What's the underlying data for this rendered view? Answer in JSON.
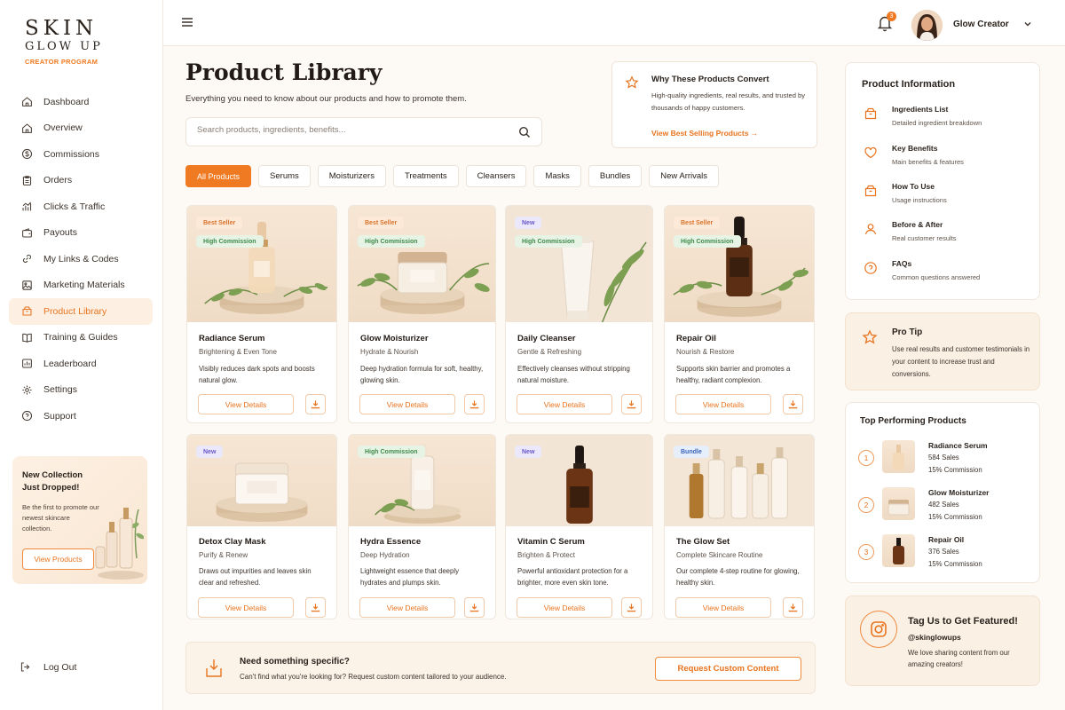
{
  "brand": {
    "line1": "SKIN",
    "line2": "GLOW UP",
    "line3": "CREATOR PROGRAM"
  },
  "nav": [
    {
      "label": "Dashboard",
      "icon": "home-icon"
    },
    {
      "label": "Overview",
      "icon": "home-icon"
    },
    {
      "label": "Commissions",
      "icon": "dollar-icon"
    },
    {
      "label": "Orders",
      "icon": "clipboard-icon"
    },
    {
      "label": "Clicks & Traffic",
      "icon": "chart-icon"
    },
    {
      "label": "Payouts",
      "icon": "wallet-icon"
    },
    {
      "label": "My Links & Codes",
      "icon": "link-icon"
    },
    {
      "label": "Marketing Materials",
      "icon": "image-icon"
    },
    {
      "label": "Product Library",
      "icon": "box-icon",
      "active": true
    },
    {
      "label": "Training & Guides",
      "icon": "book-icon"
    },
    {
      "label": "Leaderboard",
      "icon": "trophy-icon"
    },
    {
      "label": "Settings",
      "icon": "gear-icon"
    },
    {
      "label": "Support",
      "icon": "help-icon"
    }
  ],
  "promo": {
    "title": "New Collection Just Dropped!",
    "text": "Be the first to promote our newest skincare collection.",
    "button": "View Products"
  },
  "logout": "Log Out",
  "topbar": {
    "notification_count": "3",
    "user_name": "Glow Creator"
  },
  "page": {
    "title": "Product Library",
    "subtitle": "Everything you need to know about our products and how to promote them."
  },
  "search": {
    "placeholder": "Search products, ingredients, benefits..."
  },
  "convert": {
    "title": "Why These Products Convert",
    "text": "High-quality ingredients, real results, and trusted by thousands of happy customers.",
    "link": "View Best Selling Products →"
  },
  "tabs": [
    "All Products",
    "Serums",
    "Moisturizers",
    "Treatments",
    "Cleansers",
    "Masks",
    "Bundles",
    "New Arrivals"
  ],
  "products": [
    {
      "name": "Radiance Serum",
      "sub": "Brightening & Even Tone",
      "desc": "Visibly reduces dark spots and boosts natural glow.",
      "badges": [
        "Best Seller",
        "High Commission"
      ]
    },
    {
      "name": "Glow Moisturizer",
      "sub": "Hydrate & Nourish",
      "desc": "Deep hydration formula for soft, healthy, glowing skin.",
      "badges": [
        "Best Seller",
        "High Commission"
      ]
    },
    {
      "name": "Daily Cleanser",
      "sub": "Gentle & Refreshing",
      "desc": "Effectively cleanses without stripping natural moisture.",
      "badges": [
        "New",
        "High Commission"
      ]
    },
    {
      "name": "Repair Oil",
      "sub": "Nourish & Restore",
      "desc": "Supports skin barrier and promotes a healthy, radiant complexion.",
      "badges": [
        "Best Seller",
        "High Commission"
      ]
    },
    {
      "name": "Detox Clay Mask",
      "sub": "Purify & Renew",
      "desc": "Draws out impurities and leaves skin clear and refreshed.",
      "badges": [
        "New"
      ]
    },
    {
      "name": "Hydra Essence",
      "sub": "Deep Hydration",
      "desc": "Lightweight essence that deeply hydrates and plumps skin.",
      "badges": [
        "High Commission"
      ]
    },
    {
      "name": "Vitamin C Serum",
      "sub": "Brighten & Protect",
      "desc": "Powerful antioxidant protection for a brighter, more even skin tone.",
      "badges": [
        "New"
      ]
    },
    {
      "name": "The Glow Set",
      "sub": "Complete Skincare Routine",
      "desc": "Our complete 4-step routine for glowing, healthy skin.",
      "badges": [
        "Bundle"
      ]
    }
  ],
  "view_details": "View Details",
  "custom": {
    "title": "Need something specific?",
    "text": "Can't find what you're looking for? Request custom content tailored to your audience.",
    "button": "Request Custom Content"
  },
  "info": {
    "title": "Product Information",
    "items": [
      {
        "name": "Ingredients List",
        "sub": "Detailed ingredient breakdown",
        "icon": "flask-icon"
      },
      {
        "name": "Key Benefits",
        "sub": "Main benefits & features",
        "icon": "heart-icon"
      },
      {
        "name": "How To Use",
        "sub": "Usage instructions",
        "icon": "box-icon"
      },
      {
        "name": "Before & After",
        "sub": "Real customer results",
        "icon": "user-icon"
      },
      {
        "name": "FAQs",
        "sub": "Common questions answered",
        "icon": "help-icon"
      }
    ]
  },
  "tip": {
    "title": "Pro Tip",
    "text": "Use real results and customer testimonials in your content to increase trust and conversions."
  },
  "top_products": {
    "title": "Top Performing Products",
    "items": [
      {
        "rank": "1",
        "name": "Radiance Serum",
        "sales": "584 Sales",
        "commission": "15% Commission"
      },
      {
        "rank": "2",
        "name": "Glow Moisturizer",
        "sales": "482 Sales",
        "commission": "15% Commission"
      },
      {
        "rank": "3",
        "name": "Repair Oil",
        "sales": "376 Sales",
        "commission": "15% Commission"
      }
    ]
  },
  "tag": {
    "title": "Tag Us to Get Featured!",
    "handle": "@skinglowups",
    "text": "We love sharing content from our amazing creators!"
  },
  "colors": {
    "accent": "#ef7a22",
    "accent_dark": "#e8741f",
    "background": "#fdfaf6"
  }
}
